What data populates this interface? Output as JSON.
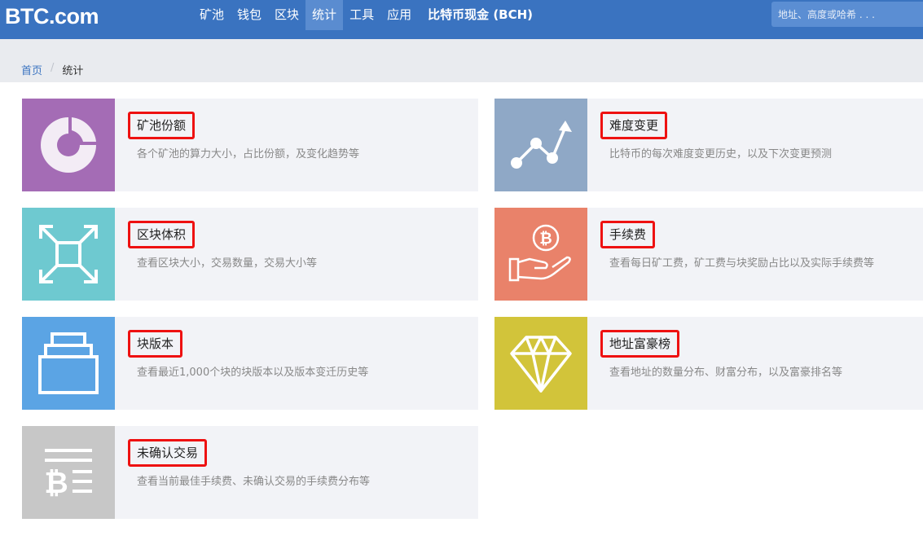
{
  "header": {
    "logo": "BTC.com",
    "nav": [
      "矿池",
      "钱包",
      "区块",
      "统计",
      "工具",
      "应用"
    ],
    "nav_active": "统计",
    "nav_bch": "比特币现金 (BCH)",
    "search_placeholder": "地址、高度或哈希 . . ."
  },
  "breadcrumb": {
    "home": "首页",
    "separator": "/",
    "current": "统计"
  },
  "cards": [
    {
      "title": "矿池份额",
      "desc": "各个矿池的算力大小，占比份额，及变化趋势等",
      "color": "#a46cb5",
      "icon": "pie-chart-icon"
    },
    {
      "title": "难度变更",
      "desc": "比特币的每次难度变更历史，以及下次变更预测",
      "color": "#8fa8c6",
      "icon": "trend-line-icon"
    },
    {
      "title": "区块体积",
      "desc": "查看区块大小，交易数量，交易大小等",
      "color": "#6ec9d0",
      "icon": "expand-arrows-icon"
    },
    {
      "title": "手续费",
      "desc": "查看每日矿工费，矿工费与块奖励占比以及实际手续费等",
      "color": "#e9826a",
      "icon": "bitcoin-hand-icon"
    },
    {
      "title": "块版本",
      "desc": "查看最近1,000个块的块版本以及版本变迁历史等",
      "color": "#5ba4e4",
      "icon": "stacked-blocks-icon"
    },
    {
      "title": "地址富豪榜",
      "desc": "查看地址的数量分布、财富分布，以及富豪排名等",
      "color": "#d2c43a",
      "icon": "diamond-icon"
    },
    {
      "title": "未确认交易",
      "desc": "查看当前最佳手续费、未确认交易的手续费分布等",
      "color": "#c7c7c7",
      "icon": "bitcoin-list-icon"
    }
  ]
}
